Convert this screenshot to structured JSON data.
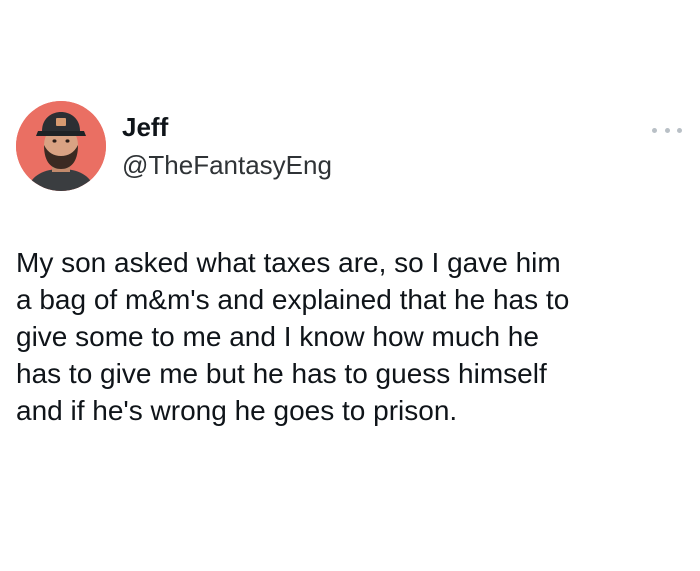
{
  "tweet": {
    "author": {
      "display_name": "Jeff",
      "handle": "@TheFantasyEng",
      "avatar_icon": "profile-photo"
    },
    "more_icon": "more-options-icon",
    "text": "My son asked what taxes are, so I gave him\na bag of m&m's and explained that he has to\ngive some to me and I know how much he\nhas to give me but he has to guess himself\nand if he's wrong he goes to prison."
  },
  "colors": {
    "avatar_background": "#ea6f63",
    "text": "#0f1419",
    "handle": "#2f3336",
    "more_dots": "#b9c0c6"
  }
}
